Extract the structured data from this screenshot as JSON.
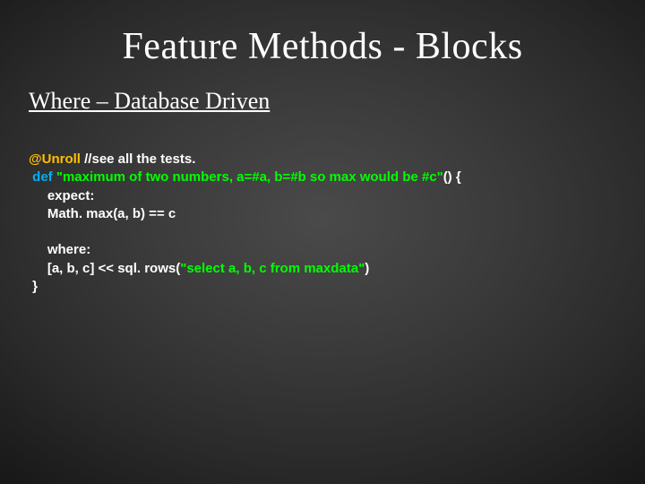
{
  "title": "Feature Methods - Blocks",
  "subtitle": "Where – Database Driven",
  "code": {
    "annotation": "@Unroll",
    "comment": " //see all the tests.",
    "def_kw": " def ",
    "method_name": "\"maximum of two numbers, a=#a, b=#b so max would be #c\"",
    "parens_brace": "() {",
    "expect_line": "     expect:",
    "math_line": "     Math. max(a, b) == c",
    "blank": "",
    "where_line": "     where:",
    "rows_pre": "     [a, b, c] << sql. rows(",
    "rows_str": "\"select a, b, c from maxdata\"",
    "rows_post": ")",
    "close_brace": " }"
  }
}
